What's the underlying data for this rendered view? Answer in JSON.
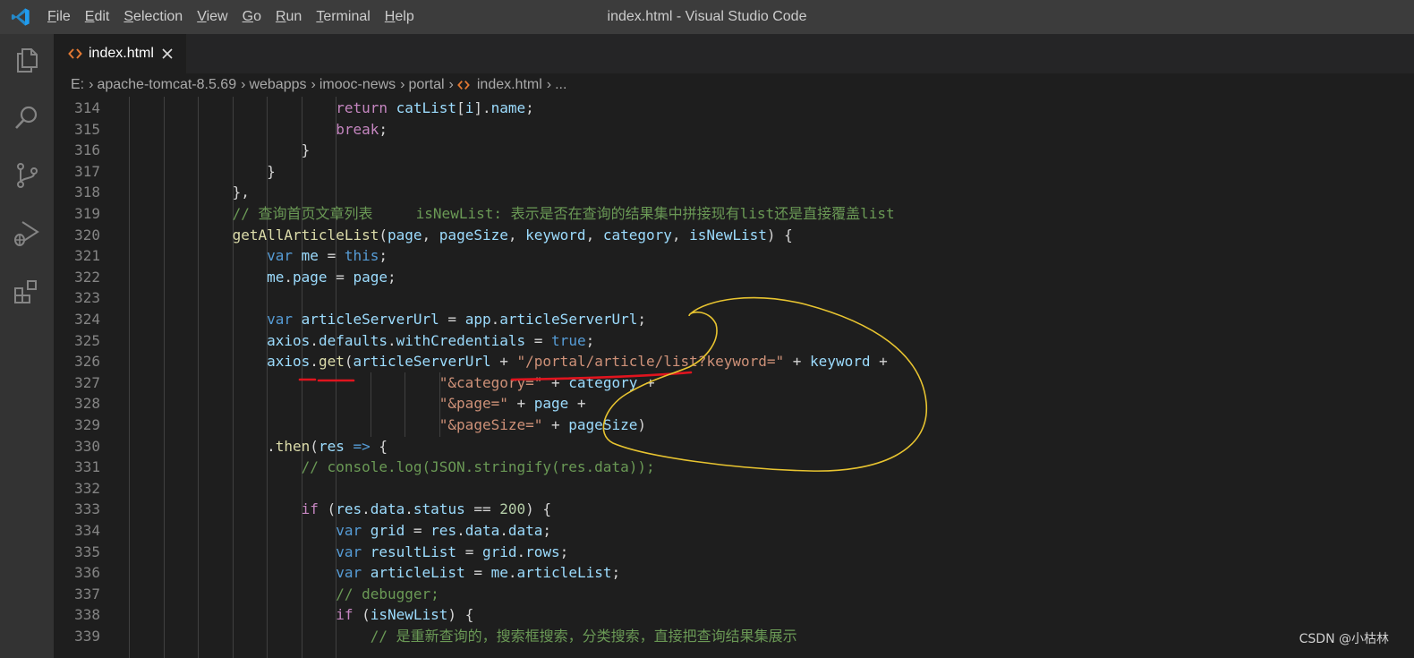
{
  "window": {
    "title": "index.html - Visual Studio Code",
    "menu": [
      {
        "mnemonic": "F",
        "rest": "ile"
      },
      {
        "mnemonic": "E",
        "rest": "dit"
      },
      {
        "mnemonic": "S",
        "rest": "election"
      },
      {
        "mnemonic": "V",
        "rest": "iew"
      },
      {
        "mnemonic": "G",
        "rest": "o"
      },
      {
        "mnemonic": "R",
        "rest": "un"
      },
      {
        "mnemonic": "T",
        "rest": "erminal"
      },
      {
        "mnemonic": "H",
        "rest": "elp"
      }
    ]
  },
  "activity_bar": [
    "files-icon",
    "search-icon",
    "source-control-icon",
    "run-debug-icon",
    "extensions-icon"
  ],
  "tab": {
    "label": "index.html",
    "icon": "html-file-icon",
    "close_icon": "close-icon"
  },
  "breadcrumb": [
    "E:",
    "apache-tomcat-8.5.69",
    "webapps",
    "imooc-news",
    "portal",
    "index.html",
    "..."
  ],
  "editor": {
    "lines": [
      {
        "n": "314",
        "code": [
          [
            "t-pl",
            "                        "
          ],
          [
            "t-ctl",
            "return"
          ],
          [
            "t-pl",
            " "
          ],
          [
            "t-var",
            "catList"
          ],
          [
            "t-pl",
            "["
          ],
          [
            "t-var",
            "i"
          ],
          [
            "t-pl",
            "]."
          ],
          [
            "t-var",
            "name"
          ],
          [
            "t-pl",
            ";"
          ]
        ]
      },
      {
        "n": "315",
        "code": [
          [
            "t-pl",
            "                        "
          ],
          [
            "t-ctl",
            "break"
          ],
          [
            "t-pl",
            ";"
          ]
        ]
      },
      {
        "n": "316",
        "code": [
          [
            "t-pl",
            "                    }"
          ]
        ]
      },
      {
        "n": "317",
        "code": [
          [
            "t-pl",
            "                }"
          ]
        ]
      },
      {
        "n": "318",
        "code": [
          [
            "t-pl",
            "            },"
          ]
        ]
      },
      {
        "n": "319",
        "code": [
          [
            "t-pl",
            "            "
          ],
          [
            "t-com",
            "// 查询首页文章列表     isNewList: 表示是否在查询的结果集中拼接现有list还是直接覆盖list"
          ]
        ]
      },
      {
        "n": "320",
        "code": [
          [
            "t-pl",
            "            "
          ],
          [
            "t-fn",
            "getAllArticleList"
          ],
          [
            "t-pl",
            "("
          ],
          [
            "t-var",
            "page"
          ],
          [
            "t-pl",
            ", "
          ],
          [
            "t-var",
            "pageSize"
          ],
          [
            "t-pl",
            ", "
          ],
          [
            "t-var",
            "keyword"
          ],
          [
            "t-pl",
            ", "
          ],
          [
            "t-var",
            "category"
          ],
          [
            "t-pl",
            ", "
          ],
          [
            "t-var",
            "isNewList"
          ],
          [
            "t-pl",
            ") {"
          ]
        ]
      },
      {
        "n": "321",
        "code": [
          [
            "t-pl",
            "                "
          ],
          [
            "t-kw",
            "var"
          ],
          [
            "t-pl",
            " "
          ],
          [
            "t-var",
            "me"
          ],
          [
            "t-pl",
            " = "
          ],
          [
            "t-kw",
            "this"
          ],
          [
            "t-pl",
            ";"
          ]
        ]
      },
      {
        "n": "322",
        "code": [
          [
            "t-pl",
            "                "
          ],
          [
            "t-var",
            "me"
          ],
          [
            "t-pl",
            "."
          ],
          [
            "t-var",
            "page"
          ],
          [
            "t-pl",
            " = "
          ],
          [
            "t-var",
            "page"
          ],
          [
            "t-pl",
            ";"
          ]
        ]
      },
      {
        "n": "323",
        "code": []
      },
      {
        "n": "324",
        "code": [
          [
            "t-pl",
            "                "
          ],
          [
            "t-kw",
            "var"
          ],
          [
            "t-pl",
            " "
          ],
          [
            "t-var",
            "articleServerUrl"
          ],
          [
            "t-pl",
            " = "
          ],
          [
            "t-var",
            "app"
          ],
          [
            "t-pl",
            "."
          ],
          [
            "t-var",
            "articleServerUrl"
          ],
          [
            "t-pl",
            ";"
          ]
        ]
      },
      {
        "n": "325",
        "code": [
          [
            "t-pl",
            "                "
          ],
          [
            "t-var",
            "axios"
          ],
          [
            "t-pl",
            "."
          ],
          [
            "t-var",
            "defaults"
          ],
          [
            "t-pl",
            "."
          ],
          [
            "t-var",
            "withCredentials"
          ],
          [
            "t-pl",
            " = "
          ],
          [
            "t-kw",
            "true"
          ],
          [
            "t-pl",
            ";"
          ]
        ]
      },
      {
        "n": "326",
        "code": [
          [
            "t-pl",
            "                "
          ],
          [
            "t-var",
            "axios"
          ],
          [
            "t-pl",
            "."
          ],
          [
            "t-fn",
            "get"
          ],
          [
            "t-pl",
            "("
          ],
          [
            "t-var",
            "articleServerUrl"
          ],
          [
            "t-pl",
            " + "
          ],
          [
            "t-str",
            "\"/portal/article/list?keyword=\""
          ],
          [
            "t-pl",
            " + "
          ],
          [
            "t-var",
            "keyword"
          ],
          [
            "t-pl",
            " +"
          ]
        ]
      },
      {
        "n": "327",
        "code": [
          [
            "t-pl",
            "                                    "
          ],
          [
            "t-str",
            "\"&category=\""
          ],
          [
            "t-pl",
            " + "
          ],
          [
            "t-var",
            "category"
          ],
          [
            "t-pl",
            " +"
          ]
        ]
      },
      {
        "n": "328",
        "code": [
          [
            "t-pl",
            "                                    "
          ],
          [
            "t-str",
            "\"&page=\""
          ],
          [
            "t-pl",
            " + "
          ],
          [
            "t-var",
            "page"
          ],
          [
            "t-pl",
            " +"
          ]
        ]
      },
      {
        "n": "329",
        "code": [
          [
            "t-pl",
            "                                    "
          ],
          [
            "t-str",
            "\"&pageSize=\""
          ],
          [
            "t-pl",
            " + "
          ],
          [
            "t-var",
            "pageSize"
          ],
          [
            "t-pl",
            ")"
          ]
        ]
      },
      {
        "n": "330",
        "code": [
          [
            "t-pl",
            "                ."
          ],
          [
            "t-fn",
            "then"
          ],
          [
            "t-pl",
            "("
          ],
          [
            "t-var",
            "res"
          ],
          [
            "t-pl",
            " "
          ],
          [
            "t-kw",
            "=>"
          ],
          [
            "t-pl",
            " {"
          ]
        ]
      },
      {
        "n": "331",
        "code": [
          [
            "t-pl",
            "                    "
          ],
          [
            "t-com",
            "// console.log(JSON.stringify(res.data));"
          ]
        ]
      },
      {
        "n": "332",
        "code": []
      },
      {
        "n": "333",
        "code": [
          [
            "t-pl",
            "                    "
          ],
          [
            "t-ctl",
            "if"
          ],
          [
            "t-pl",
            " ("
          ],
          [
            "t-var",
            "res"
          ],
          [
            "t-pl",
            "."
          ],
          [
            "t-var",
            "data"
          ],
          [
            "t-pl",
            "."
          ],
          [
            "t-var",
            "status"
          ],
          [
            "t-pl",
            " == "
          ],
          [
            "t-num",
            "200"
          ],
          [
            "t-pl",
            ") {"
          ]
        ]
      },
      {
        "n": "334",
        "code": [
          [
            "t-pl",
            "                        "
          ],
          [
            "t-kw",
            "var"
          ],
          [
            "t-pl",
            " "
          ],
          [
            "t-var",
            "grid"
          ],
          [
            "t-pl",
            " = "
          ],
          [
            "t-var",
            "res"
          ],
          [
            "t-pl",
            "."
          ],
          [
            "t-var",
            "data"
          ],
          [
            "t-pl",
            "."
          ],
          [
            "t-var",
            "data"
          ],
          [
            "t-pl",
            ";"
          ]
        ]
      },
      {
        "n": "335",
        "code": [
          [
            "t-pl",
            "                        "
          ],
          [
            "t-kw",
            "var"
          ],
          [
            "t-pl",
            " "
          ],
          [
            "t-var",
            "resultList"
          ],
          [
            "t-pl",
            " = "
          ],
          [
            "t-var",
            "grid"
          ],
          [
            "t-pl",
            "."
          ],
          [
            "t-var",
            "rows"
          ],
          [
            "t-pl",
            ";"
          ]
        ]
      },
      {
        "n": "336",
        "code": [
          [
            "t-pl",
            "                        "
          ],
          [
            "t-kw",
            "var"
          ],
          [
            "t-pl",
            " "
          ],
          [
            "t-var",
            "articleList"
          ],
          [
            "t-pl",
            " = "
          ],
          [
            "t-var",
            "me"
          ],
          [
            "t-pl",
            "."
          ],
          [
            "t-var",
            "articleList"
          ],
          [
            "t-pl",
            ";"
          ]
        ]
      },
      {
        "n": "337",
        "code": [
          [
            "t-pl",
            "                        "
          ],
          [
            "t-com",
            "// debugger;"
          ]
        ]
      },
      {
        "n": "338",
        "code": [
          [
            "t-pl",
            "                        "
          ],
          [
            "t-ctl",
            "if"
          ],
          [
            "t-pl",
            " ("
          ],
          [
            "t-var",
            "isNewList"
          ],
          [
            "t-pl",
            ") {"
          ]
        ]
      },
      {
        "n": "339",
        "code": [
          [
            "t-pl",
            "                            "
          ],
          [
            "t-com",
            "// 是重新查询的，搜索框搜索，分类搜索，直接把查询结果集展示"
          ]
        ]
      }
    ]
  },
  "watermark": "CSDN @小枯林",
  "colors": {
    "annotation_red": "#e0141e",
    "annotation_yellow": "#e8c430"
  }
}
